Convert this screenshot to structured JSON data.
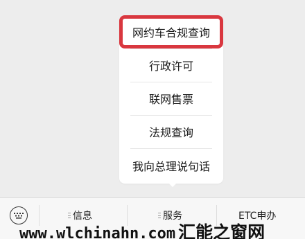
{
  "popup_menu": {
    "items": [
      {
        "label": "网约车合规查询",
        "highlighted": true
      },
      {
        "label": "行政许可",
        "highlighted": false
      },
      {
        "label": "联网售票",
        "highlighted": false
      },
      {
        "label": "法规查询",
        "highlighted": false
      },
      {
        "label": "我向总理说句话",
        "highlighted": false
      }
    ],
    "highlight_color": "#d9373f"
  },
  "tab_bar": {
    "keyboard_icon": "keyboard-icon",
    "tabs": [
      {
        "label": "信息",
        "icon": "menu-glyph"
      },
      {
        "label": "服务",
        "icon": "menu-glyph"
      },
      {
        "label": "ETC申办",
        "icon": ""
      }
    ]
  },
  "watermark": {
    "url": "www.wlchinahn.com",
    "text": "汇能之窗网"
  }
}
